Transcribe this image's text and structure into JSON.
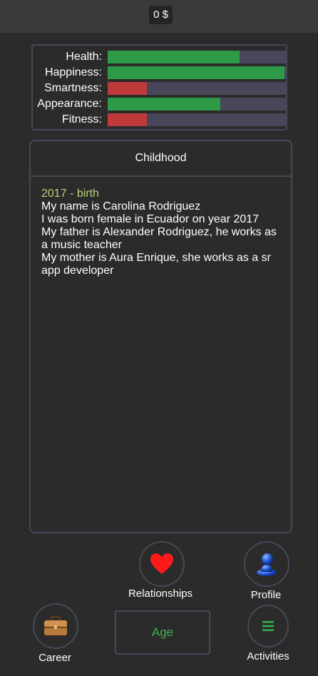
{
  "header": {
    "money": "0 $"
  },
  "stats": [
    {
      "label": "Health:",
      "value": 0.74,
      "color": "#2e9a48"
    },
    {
      "label": "Happiness:",
      "value": 0.99,
      "color": "#2e9a48"
    },
    {
      "label": "Smartness:",
      "value": 0.22,
      "color": "#c0393b"
    },
    {
      "label": "Appearance:",
      "value": 0.63,
      "color": "#2e9a48"
    },
    {
      "label": "Fitness:",
      "value": 0.22,
      "color": "#c0393b"
    }
  ],
  "log": {
    "title": "Childhood",
    "year_line": "2017 - birth",
    "lines": [
      "My name is Carolina Rodriguez",
      "I was born female in Ecuador on year 2017",
      "My father is Alexander Rodriguez, he works as a music teacher",
      "My mother is Aura Enrique, she works as a sr app developer"
    ]
  },
  "nav": {
    "relationships_label": "Relationships",
    "relationships_icon": "heart-icon",
    "profile_label": "Profile",
    "profile_icon": "person-icon",
    "career_label": "Career",
    "career_icon": "briefcase-icon",
    "age_label": "Age",
    "activities_label": "Activities",
    "activities_icon": "menu-icon"
  },
  "colors": {
    "background": "#2b2b2b",
    "border": "#474759",
    "accent_green": "#38b24a",
    "bar_green": "#2e9a48",
    "bar_red": "#c0393b",
    "year_text": "#b9d37a"
  }
}
